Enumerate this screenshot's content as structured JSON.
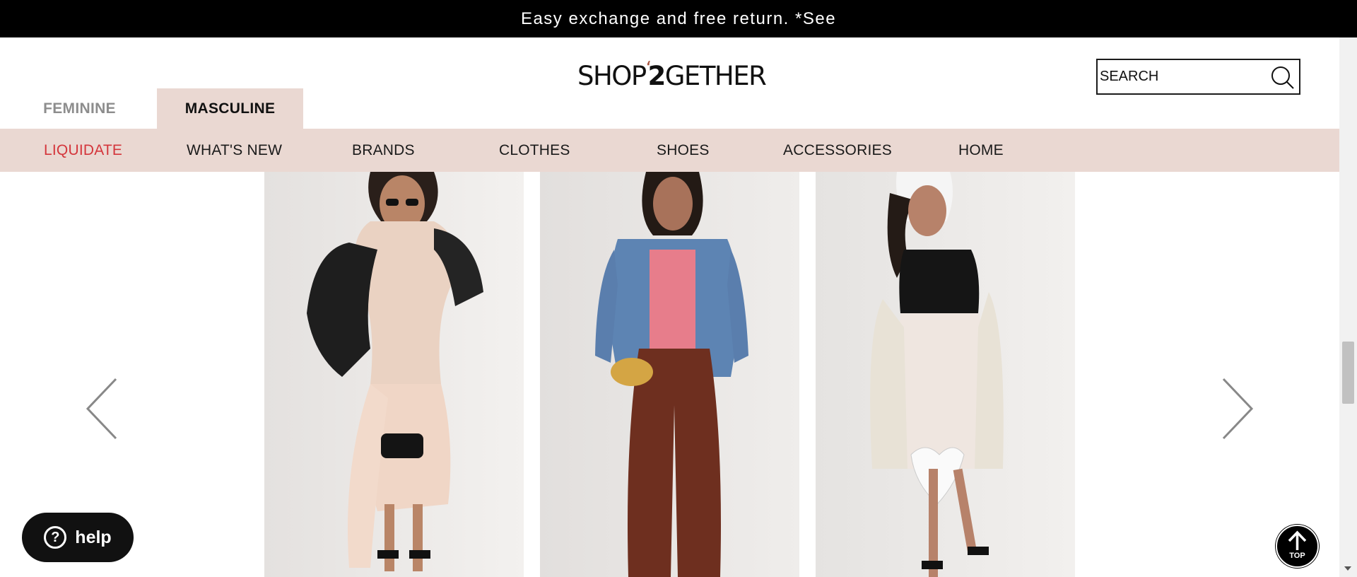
{
  "announcement": {
    "text": "Easy exchange and free return. *See"
  },
  "logo": {
    "part1": "SHOP",
    "quote": "‘",
    "two": "2",
    "part2": "GETHER"
  },
  "search": {
    "placeholder": "SEARCH",
    "icon": "search-icon"
  },
  "gender_tabs": [
    {
      "label": "FEMININE",
      "active": false
    },
    {
      "label": "MASCULINE",
      "active": true
    }
  ],
  "nav": {
    "items": [
      {
        "label": "LIQUIDATE",
        "highlight": true
      },
      {
        "label": "WHAT'S NEW"
      },
      {
        "label": "BRANDS"
      },
      {
        "label": "CLOTHES"
      },
      {
        "label": "SHOES"
      },
      {
        "label": "ACCESSORIES"
      },
      {
        "label": "HOME"
      }
    ]
  },
  "carousel": {
    "prev_icon": "chevron-left-icon",
    "next_icon": "chevron-right-icon",
    "products": [
      {
        "image": "model-black-leather-jacket-peach-ruffle-dress"
      },
      {
        "image": "model-denim-shirt-pink-top-brown-pants"
      },
      {
        "image": "model-cream-cardigan-black-slip-dress"
      }
    ]
  },
  "help": {
    "label": "help",
    "icon": "question-circle-icon"
  },
  "top_button": {
    "label": "TOP",
    "icon": "arrow-up-icon"
  },
  "colors": {
    "nav_bg": "#ead8d2",
    "sale_red": "#d4353b",
    "announce_bg": "#000000",
    "logo_accent": "#a8533d"
  }
}
